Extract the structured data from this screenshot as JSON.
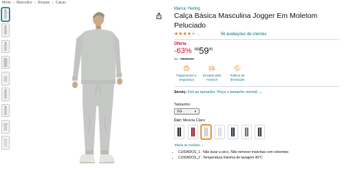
{
  "breadcrumb": [
    "Moda",
    "›",
    "Masculino",
    "›",
    "Roupas",
    "›",
    "Calças"
  ],
  "product": {
    "brand": "Marca: Hering",
    "title": "Calça Básica Masculina Jogger Em Moletom Peluciado",
    "rating": 4.5,
    "stars": [
      "★",
      "★",
      "★",
      "★",
      "★"
    ],
    "rating_chevron": "⌄",
    "reviews": "56 avaliações de clientes",
    "deal_label": "Oferta",
    "discount": "-63%",
    "currency": "R$",
    "price_whole": "59",
    "price_cents": "90",
    "list_price_label": "De:",
    "list_price": "R$159,90",
    "features": [
      {
        "icon": "card-icon",
        "label": "Pagamentos e Segurança"
      },
      {
        "icon": "truck-icon",
        "label": "Enviado pela Amazon"
      },
      {
        "icon": "return-icon",
        "label": "Política de devolução"
      }
    ],
    "service_label": "Serviç:",
    "service_value": "Fiel ao tamanho. Peça o tamanho normal.",
    "service_chevron": "⌄",
    "size_label": "Tamanho:",
    "size_value": "XG",
    "size_caret": "▼",
    "color_label": "Cor:",
    "color_value": "Mescla Claro",
    "size_table": "Tabela de medidas",
    "size_table_chevron": "⌄",
    "care": [
      "CUIDADOS_1 : Não lavar a seco. Não remover manchas com solventes",
      "CUIDADOS_2 : Temperatura máxima de lavagem 40ºC"
    ]
  },
  "colors": {
    "link": "#007185",
    "deal": "#cc0c39",
    "star": "#de7921",
    "swatch_selected": "#e77600",
    "garment": "#c6c8c6"
  }
}
